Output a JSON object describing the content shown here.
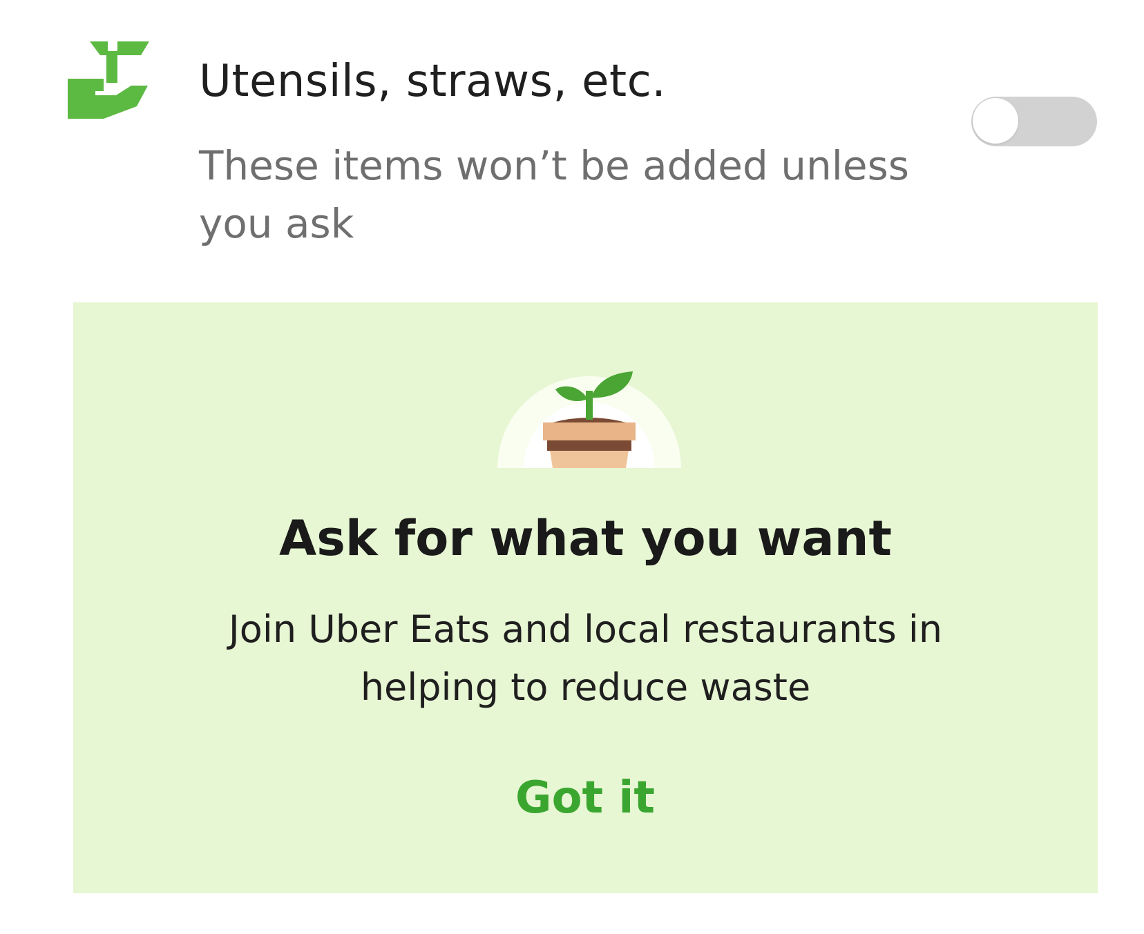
{
  "option": {
    "icon": "sprout-in-hand-icon",
    "title": "Utensils, straws, etc.",
    "subtitle": "These items won’t be added unless you ask",
    "toggle_on": false
  },
  "promo": {
    "illustration": "potted-sprout-illustration",
    "title": "Ask for what you want",
    "body": "Join Uber Eats and local restaurants in helping to reduce waste",
    "button_label": "Got it"
  },
  "colors": {
    "accent_green": "#3aa62f",
    "icon_green": "#5cb942",
    "card_background": "#e7f6d3",
    "toggle_off": "#d2d2d2",
    "pot_light": "#f0c49a",
    "pot_dark": "#7b4a35"
  }
}
